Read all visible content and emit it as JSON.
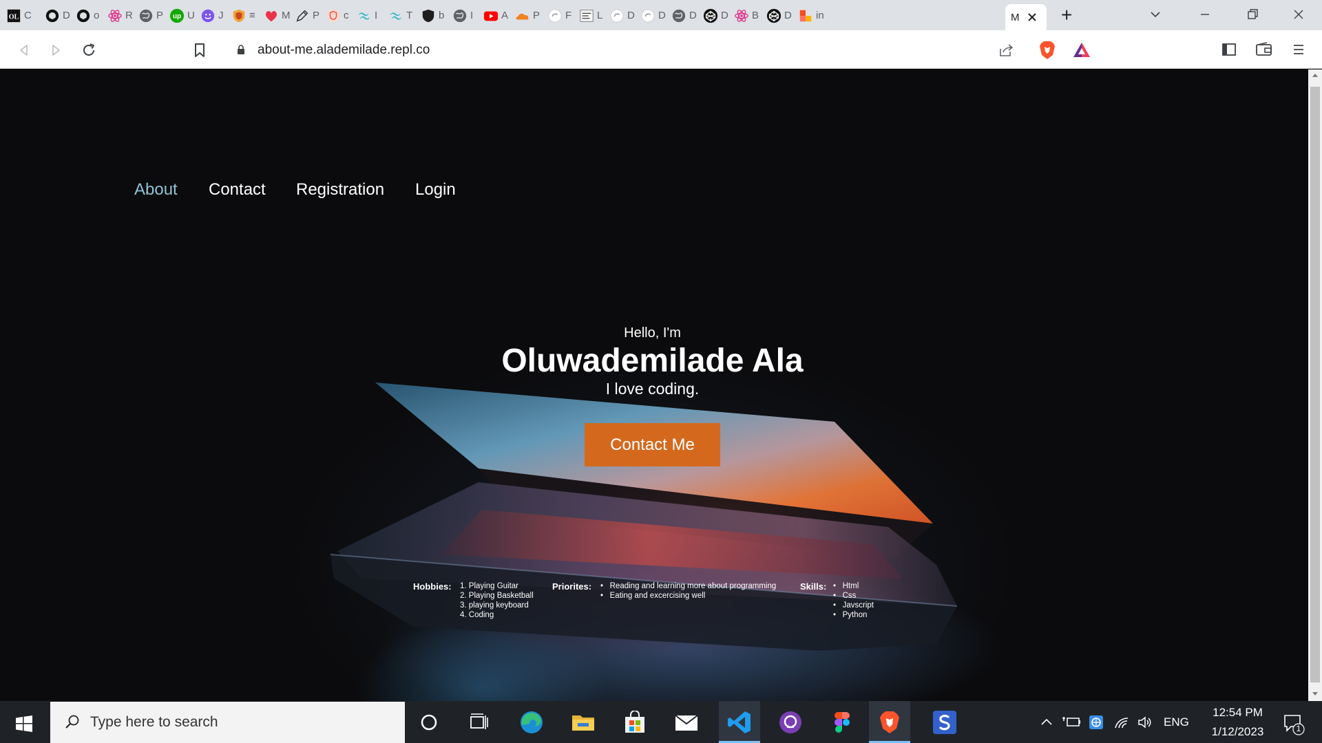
{
  "browser": {
    "tabs": [
      {
        "icon": "ol-logo-icon",
        "title": "C"
      },
      {
        "icon": "github-icon",
        "title": "D"
      },
      {
        "icon": "github-icon",
        "title": "o"
      },
      {
        "icon": "react-icon",
        "title": "R"
      },
      {
        "icon": "globe-icon",
        "title": "P"
      },
      {
        "icon": "upwork-icon",
        "title": "U"
      },
      {
        "icon": "smiley-icon",
        "title": "J"
      },
      {
        "icon": "shield-badge-icon",
        "title": "≡"
      },
      {
        "icon": "heart-icon",
        "title": "M"
      },
      {
        "icon": "pen-icon",
        "title": "P"
      },
      {
        "icon": "brave-shield-icon",
        "title": "c"
      },
      {
        "icon": "tailwind-icon",
        "title": "I"
      },
      {
        "icon": "tailwind-icon",
        "title": "T"
      },
      {
        "icon": "dark-shield-icon",
        "title": "b"
      },
      {
        "icon": "globe-icon",
        "title": "I"
      },
      {
        "icon": "youtube-icon",
        "title": "A"
      },
      {
        "icon": "cloudflare-icon",
        "title": "P"
      },
      {
        "icon": "round-icon",
        "title": "F"
      },
      {
        "icon": "uxpin-icon",
        "title": "L"
      },
      {
        "icon": "round-icon",
        "title": "D"
      },
      {
        "icon": "round-icon",
        "title": "D"
      },
      {
        "icon": "globe-icon",
        "title": "D"
      },
      {
        "icon": "codepen-icon",
        "title": "D"
      },
      {
        "icon": "react-icon",
        "title": "B"
      },
      {
        "icon": "codepen-icon",
        "title": "D"
      },
      {
        "icon": "figma-orange-icon",
        "title": "in"
      }
    ],
    "active_tab": {
      "title": "M",
      "icon": "close-icon"
    },
    "new_tab_symbol": "+",
    "url": "about-me.alademilade.repl.co"
  },
  "page": {
    "nav": [
      "About",
      "Contact",
      "Registration",
      "Login"
    ],
    "greeting": "Hello, I'm",
    "name": "Oluwademilade Ala",
    "tagline": "I love coding.",
    "cta": "Contact Me",
    "hobbies": {
      "label": "Hobbies:",
      "items": [
        "1. Playing Guitar",
        "2. Playing Basketball",
        "3. playing keyboard",
        "4. Coding"
      ]
    },
    "priorities": {
      "label": "Priorites:",
      "items": [
        "Reading and learning more about programming",
        "Eating and excercising well"
      ]
    },
    "skills": {
      "label": "Skills:",
      "items": [
        "Html",
        "Css",
        "Javscript",
        "Python"
      ]
    }
  },
  "taskbar": {
    "search_placeholder": "Type here to search",
    "apps": [
      "cortana-icon",
      "task-view-icon",
      "edge-icon",
      "file-explorer-icon",
      "microsoft-store-icon",
      "mail-icon",
      "vscode-icon",
      "github-desktop-icon",
      "figma-icon",
      "brave-icon",
      "simplenote-icon"
    ],
    "language": "ENG",
    "time": "12:54 PM",
    "date": "1/12/2023",
    "notification_count": "1"
  },
  "colors": {
    "accent": "#d4691e",
    "nav_active": "#8fc3d9",
    "hero_text": "#ffffff"
  }
}
